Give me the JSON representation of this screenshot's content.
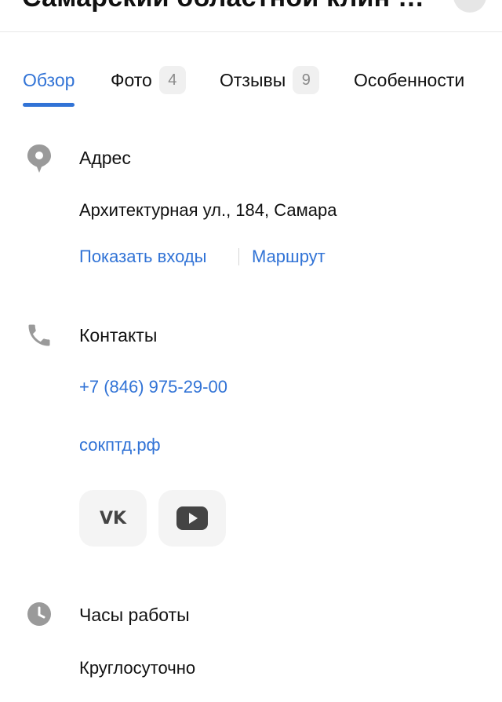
{
  "header": {
    "title": "Самарский областной клин …"
  },
  "tabs": [
    {
      "label": "Обзор"
    },
    {
      "label": "Фото",
      "badge": "4"
    },
    {
      "label": "Отзывы",
      "badge": "9"
    },
    {
      "label": "Особенности"
    }
  ],
  "address": {
    "title": "Адрес",
    "value": "Архитектурная ул., 184, Самара",
    "show_entrances": "Показать входы",
    "route": "Маршрут"
  },
  "contacts": {
    "title": "Контакты",
    "phone": "+7 (846) 975-29-00",
    "website": "сокптд.рф",
    "social": [
      {
        "name": "vk-icon",
        "label": "VK"
      },
      {
        "name": "youtube-icon"
      }
    ]
  },
  "hours": {
    "title": "Часы работы",
    "value": "Круглосуточно"
  },
  "colors": {
    "accent": "#3173d6",
    "icon_gray": "#9a9a9a"
  }
}
